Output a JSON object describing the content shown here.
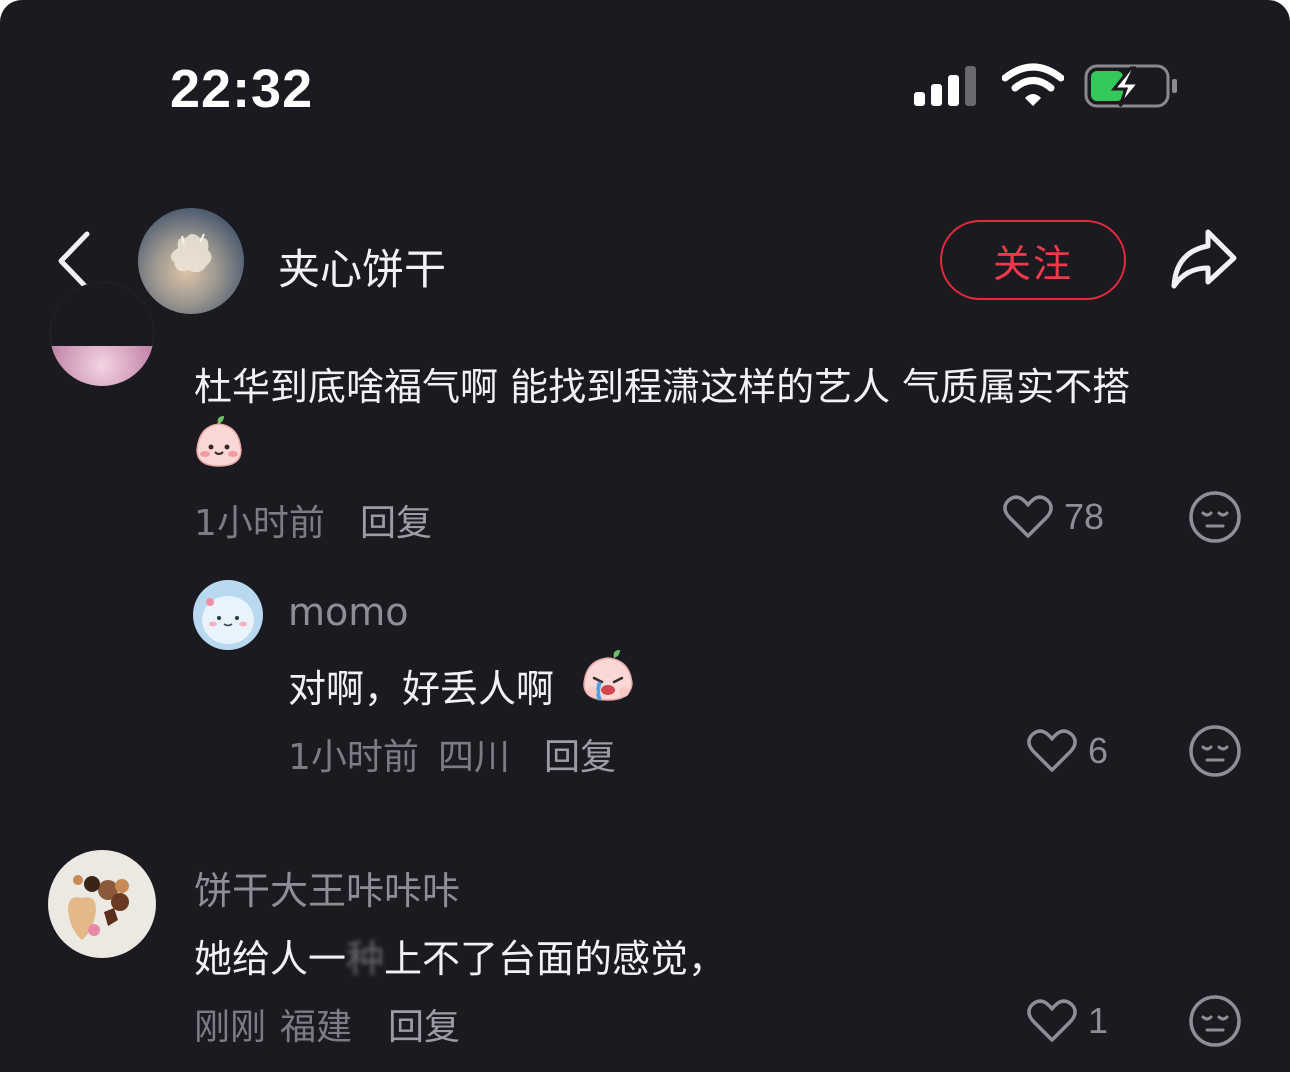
{
  "status_bar": {
    "time": "22:32"
  },
  "header": {
    "user_name": "夹心饼干",
    "follow_label": "关注"
  },
  "comments": [
    {
      "text_line1": "杜华到底啥福气啊 能找到程潇这样的艺人 气质属实不搭",
      "time": "1小时前",
      "reply_label": "回复",
      "likes": "78"
    },
    {
      "username": "momo",
      "text": "对啊，好丢人啊",
      "time": "1小时前",
      "location": "四川",
      "reply_label": "回复",
      "likes": "6"
    },
    {
      "username": "饼干大王咔咔咔",
      "text_before": "她给人一",
      "text_blurred": "种",
      "text_after": "上不了台面的感觉，",
      "time": "刚刚",
      "location": "福建",
      "reply_label": "回复",
      "likes": "1"
    }
  ]
}
